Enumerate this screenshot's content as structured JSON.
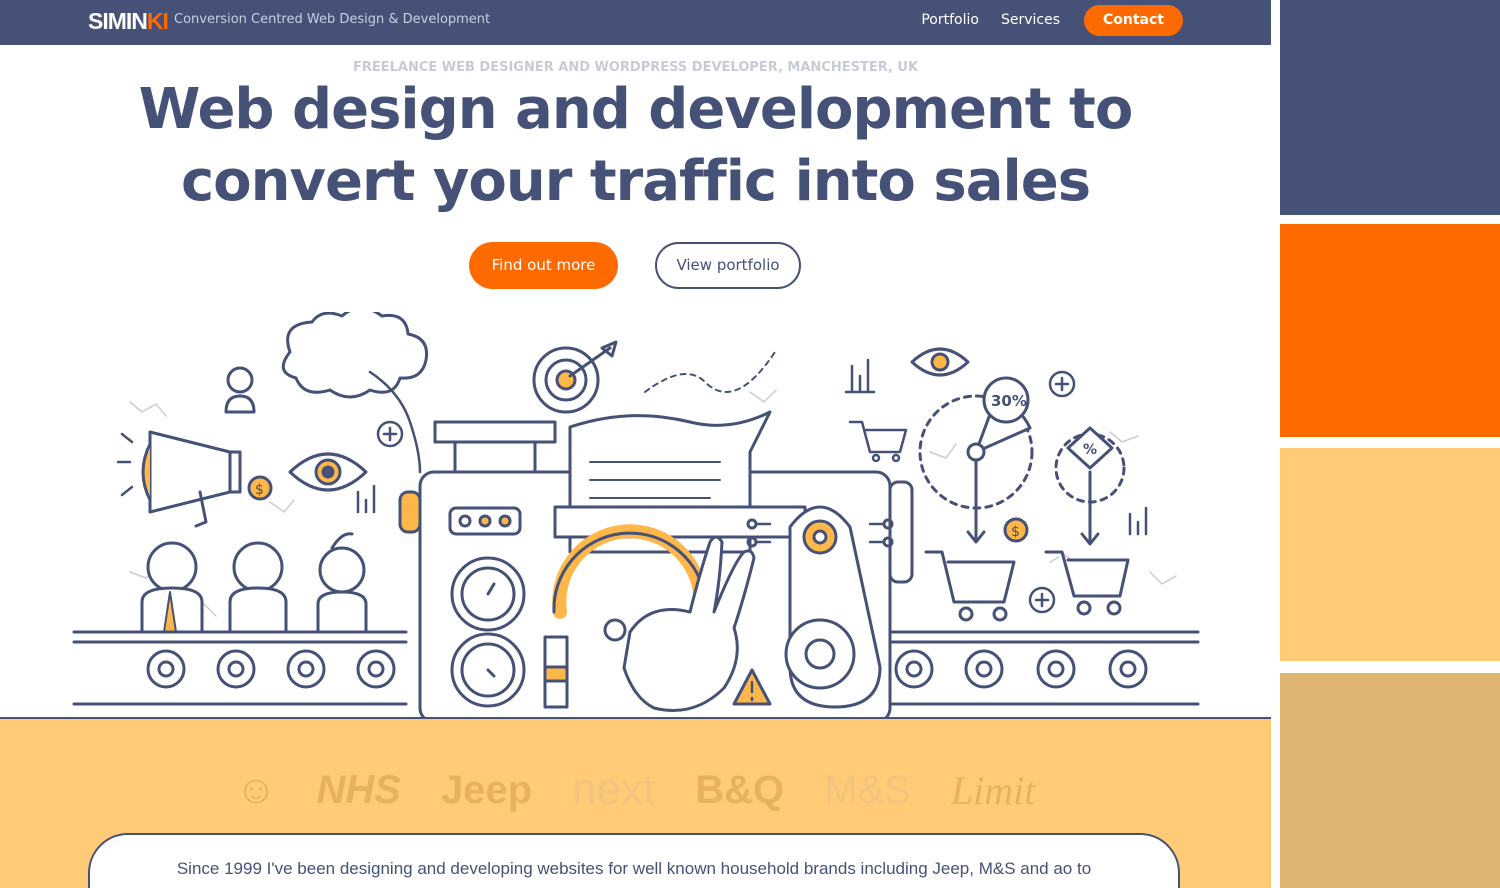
{
  "header": {
    "logo_main": "SIMIN",
    "logo_accent": "KI",
    "tagline": "Conversion Centred Web Design & Development",
    "nav": {
      "portfolio": "Portfolio",
      "services": "Services",
      "contact": "Contact"
    }
  },
  "hero": {
    "eyebrow": "FREELANCE WEB DESIGNER AND WORDPRESS DEVELOPER, MANCHESTER, UK",
    "headline_line1": "Web design and development to",
    "headline_line2": "convert your traffic into sales",
    "primary_button": "Find out more",
    "secondary_button": "View portfolio"
  },
  "illustration": {
    "badge_30": "30%",
    "badge_pct": "%",
    "dollar": "$"
  },
  "brands": [
    "☺",
    "NHS",
    "Jeep",
    "next",
    "B&Q",
    "M&S",
    "Limit"
  ],
  "intro": {
    "text": "Since 1999 I've been designing and developing websites for well known household brands including Jeep, M&S and ao to"
  },
  "palette": [
    "#465177",
    "#ff6a00",
    "#ffcb76",
    "#deb471"
  ]
}
